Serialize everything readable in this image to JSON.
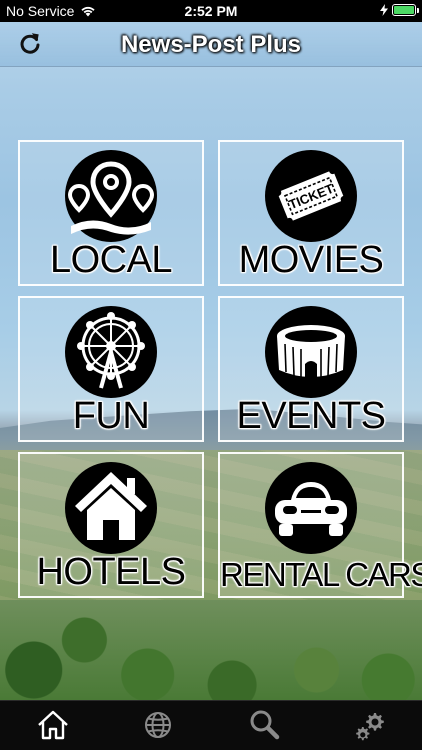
{
  "status_bar": {
    "carrier": "No Service",
    "time": "2:52 PM",
    "battery_percent": 100
  },
  "nav": {
    "title": "News-Post Plus",
    "refresh_icon": "refresh-icon"
  },
  "tiles": [
    {
      "label": "LOCAL",
      "icon": "location-pins-icon"
    },
    {
      "label": "MOVIES",
      "icon": "ticket-icon",
      "icon_text": "TICKET"
    },
    {
      "label": "FUN",
      "icon": "ferris-wheel-icon"
    },
    {
      "label": "EVENTS",
      "icon": "stadium-icon"
    },
    {
      "label": "HOTELS",
      "icon": "house-icon"
    },
    {
      "label": "RENTAL CARS",
      "icon": "car-icon"
    }
  ],
  "tab_bar": {
    "items": [
      {
        "icon": "home-icon",
        "active": true
      },
      {
        "icon": "globe-icon",
        "active": false
      },
      {
        "icon": "search-icon",
        "active": false
      },
      {
        "icon": "settings-icon",
        "active": false
      }
    ],
    "active_color": "#ffffff",
    "inactive_color": "#8a8a8a"
  },
  "colors": {
    "battery": "#4cd964",
    "status_bar_bg": "#000000",
    "tab_bar_bg": "#0b0b0b"
  }
}
